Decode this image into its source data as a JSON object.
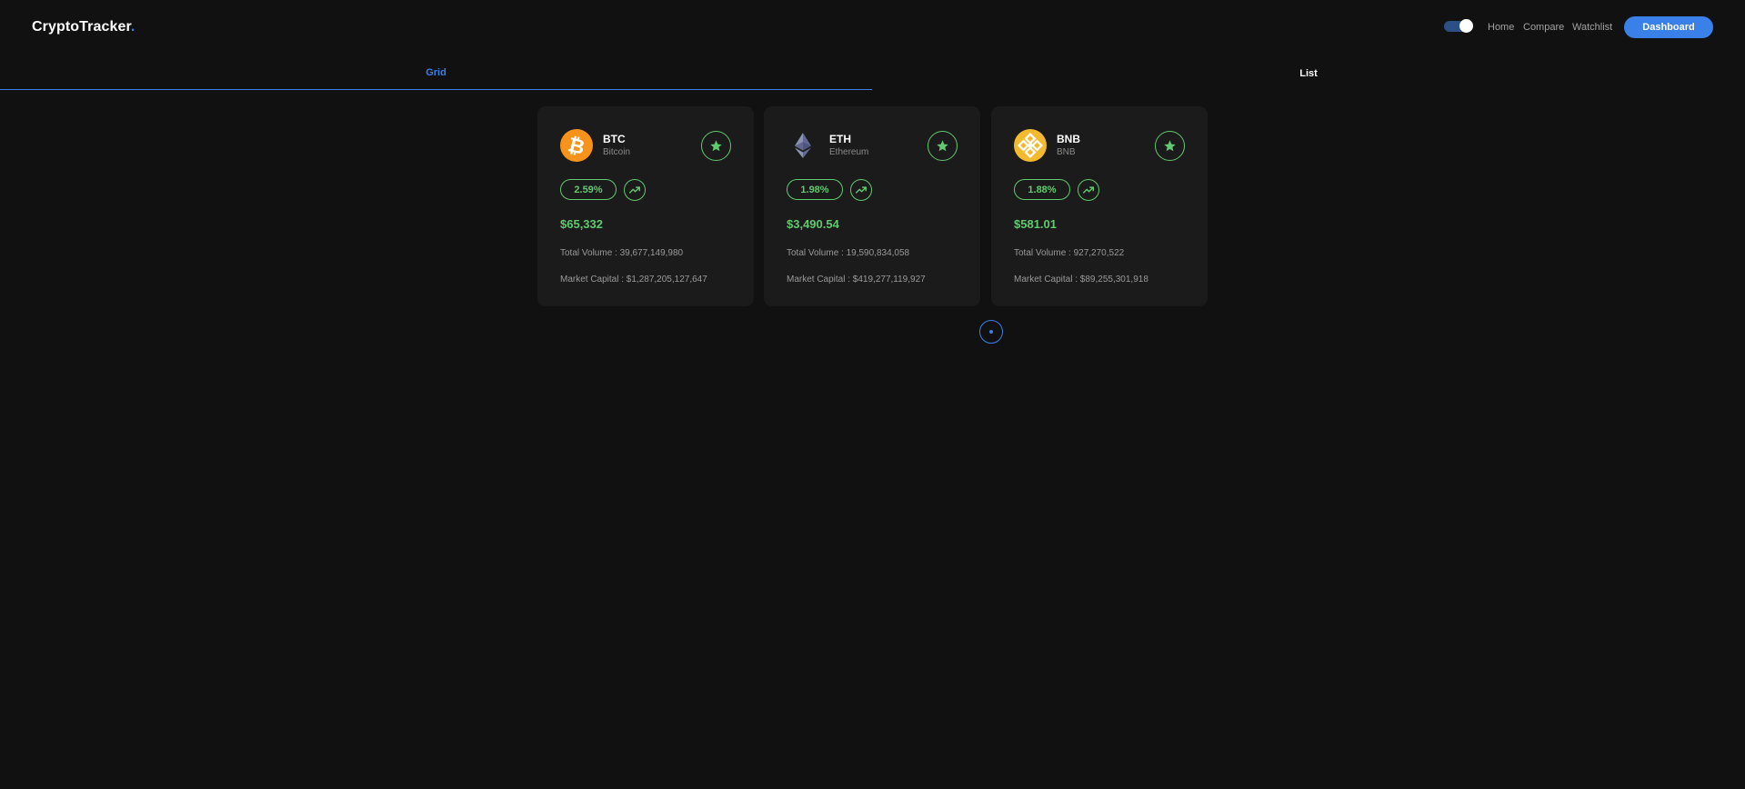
{
  "header": {
    "logo_text": "CryptoTracker",
    "logo_dot": ".",
    "nav": [
      "Home",
      "Compare",
      "Watchlist"
    ],
    "dashboard_label": "Dashboard",
    "theme_toggle_on": true
  },
  "tabs": [
    {
      "label": "Grid",
      "active": true
    },
    {
      "label": "List",
      "active": false
    }
  ],
  "coins": [
    {
      "symbol": "BTC",
      "name": "Bitcoin",
      "icon": "bitcoin-logo-icon",
      "change": "2.59%",
      "trend": "up",
      "price": "$65,332",
      "volume": "Total Volume : 39,677,149,980",
      "market_cap": "Market Capital : $1,287,205,127,647"
    },
    {
      "symbol": "ETH",
      "name": "Ethereum",
      "icon": "ethereum-logo-icon",
      "change": "1.98%",
      "trend": "up",
      "price": "$3,490.54",
      "volume": "Total Volume : 19,590,834,058",
      "market_cap": "Market Capital : $419,277,119,927"
    },
    {
      "symbol": "BNB",
      "name": "BNB",
      "icon": "bnb-logo-icon",
      "change": "1.88%",
      "trend": "up",
      "price": "$581.01",
      "volume": "Total Volume : 927,270,522",
      "market_cap": "Market Capital : $89,255,301,918"
    }
  ],
  "pagination": {
    "current_page": 1
  },
  "colors": {
    "background": "#111111",
    "card": "#1b1b1b",
    "accent": "#3a80e9",
    "positive": "#61c96f",
    "bitcoin": "#f7931a",
    "bnb": "#f3ba2f"
  }
}
